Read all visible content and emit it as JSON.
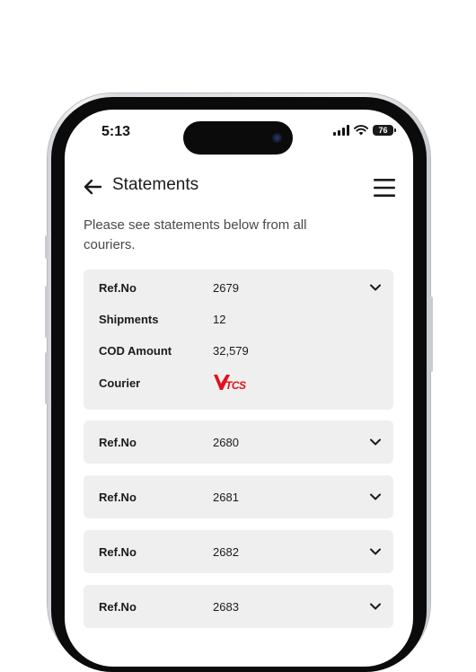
{
  "status_bar": {
    "time": "5:13",
    "battery": "76"
  },
  "header": {
    "title": "Statements"
  },
  "intro_text": "Please see statements below from all couriers.",
  "labels": {
    "ref": "Ref.No",
    "shipments": "Shipments",
    "cod_amount": "COD Amount",
    "courier": "Courier"
  },
  "statements": [
    {
      "ref": "2679",
      "shipments": "12",
      "cod_amount": "32,579",
      "courier": "TCS",
      "expanded": true
    },
    {
      "ref": "2680",
      "expanded": false
    },
    {
      "ref": "2681",
      "expanded": false
    },
    {
      "ref": "2682",
      "expanded": false
    },
    {
      "ref": "2683",
      "expanded": false
    }
  ],
  "icons": {
    "back": "arrow-left-icon",
    "menu": "hamburger-menu-icon",
    "expand": "chevron-down-icon"
  },
  "colors": {
    "card_bg": "#efefef",
    "tcs_red": "#e3101e"
  }
}
